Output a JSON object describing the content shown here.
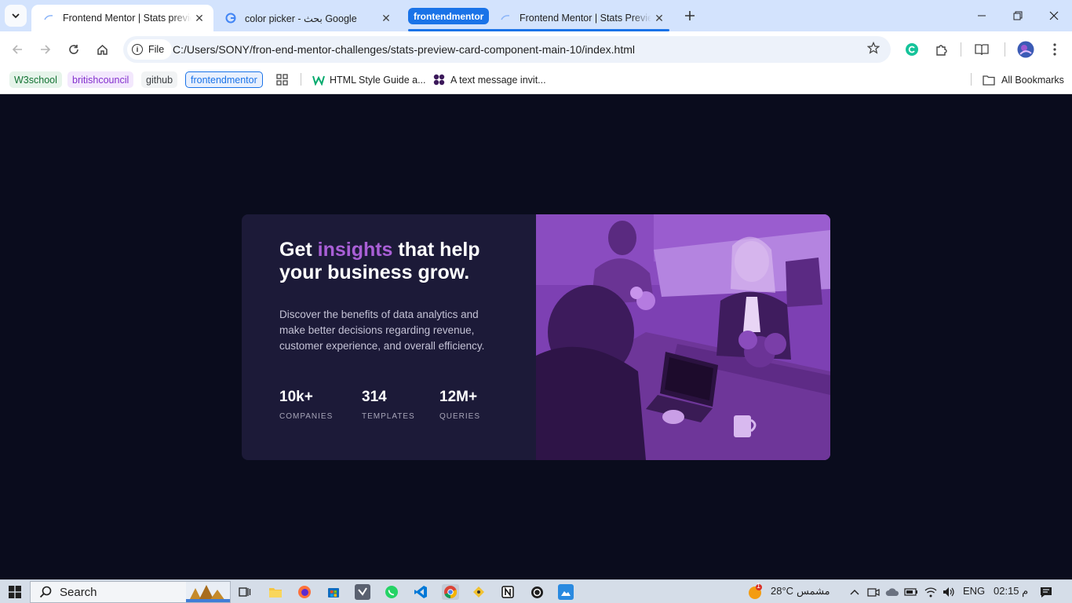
{
  "browser": {
    "tabs": [
      {
        "title": "Frontend Mentor | Stats preview",
        "active": true
      },
      {
        "title": "color picker - بحث Google",
        "active": false
      },
      {
        "title": "Frontend Mentor | Stats Preview",
        "active": false
      }
    ],
    "tab_group_label": "frontendmentor",
    "site_chip_label": "File",
    "url": "C:/Users/SONY/fron-end-mentor-challenges/stats-preview-card-component-main-10/index.html",
    "bookmarks": [
      {
        "label": "W3school",
        "bg": "#e6f4ea",
        "fg": "#137333"
      },
      {
        "label": "britishcouncil",
        "bg": "#f3e8fd",
        "fg": "#8430ce"
      },
      {
        "label": "github",
        "bg": "#f1f3f4",
        "fg": "#3c4043"
      },
      {
        "label": "frontendmentor",
        "bg": "#e8f0fe",
        "fg": "#1a73e8"
      }
    ],
    "bookmark_links": [
      {
        "label": "HTML Style Guide a..."
      },
      {
        "label": "A text message invit..."
      }
    ],
    "all_bookmarks_label": "All Bookmarks"
  },
  "card": {
    "headline_pre": "Get ",
    "headline_accent": "insights",
    "headline_post": " that help your business grow.",
    "description": "Discover the benefits of data analytics and make better decisions regarding revenue, customer experience, and overall efficiency.",
    "stats": [
      {
        "value": "10k+",
        "label": "COMPANIES"
      },
      {
        "value": "314",
        "label": "TEMPLATES"
      },
      {
        "value": "12M+",
        "label": "QUERIES"
      }
    ],
    "colors": {
      "background": "#0a0c1d",
      "card": "#1c1a38",
      "accent": "#a95fd6",
      "image_overlay": "#7b3fb0"
    }
  },
  "taskbar": {
    "search_label": "Search",
    "weather_temp": "28°C",
    "weather_text": "مشمس",
    "weather_badge": "1",
    "language": "ENG",
    "time": "02:15 م"
  }
}
